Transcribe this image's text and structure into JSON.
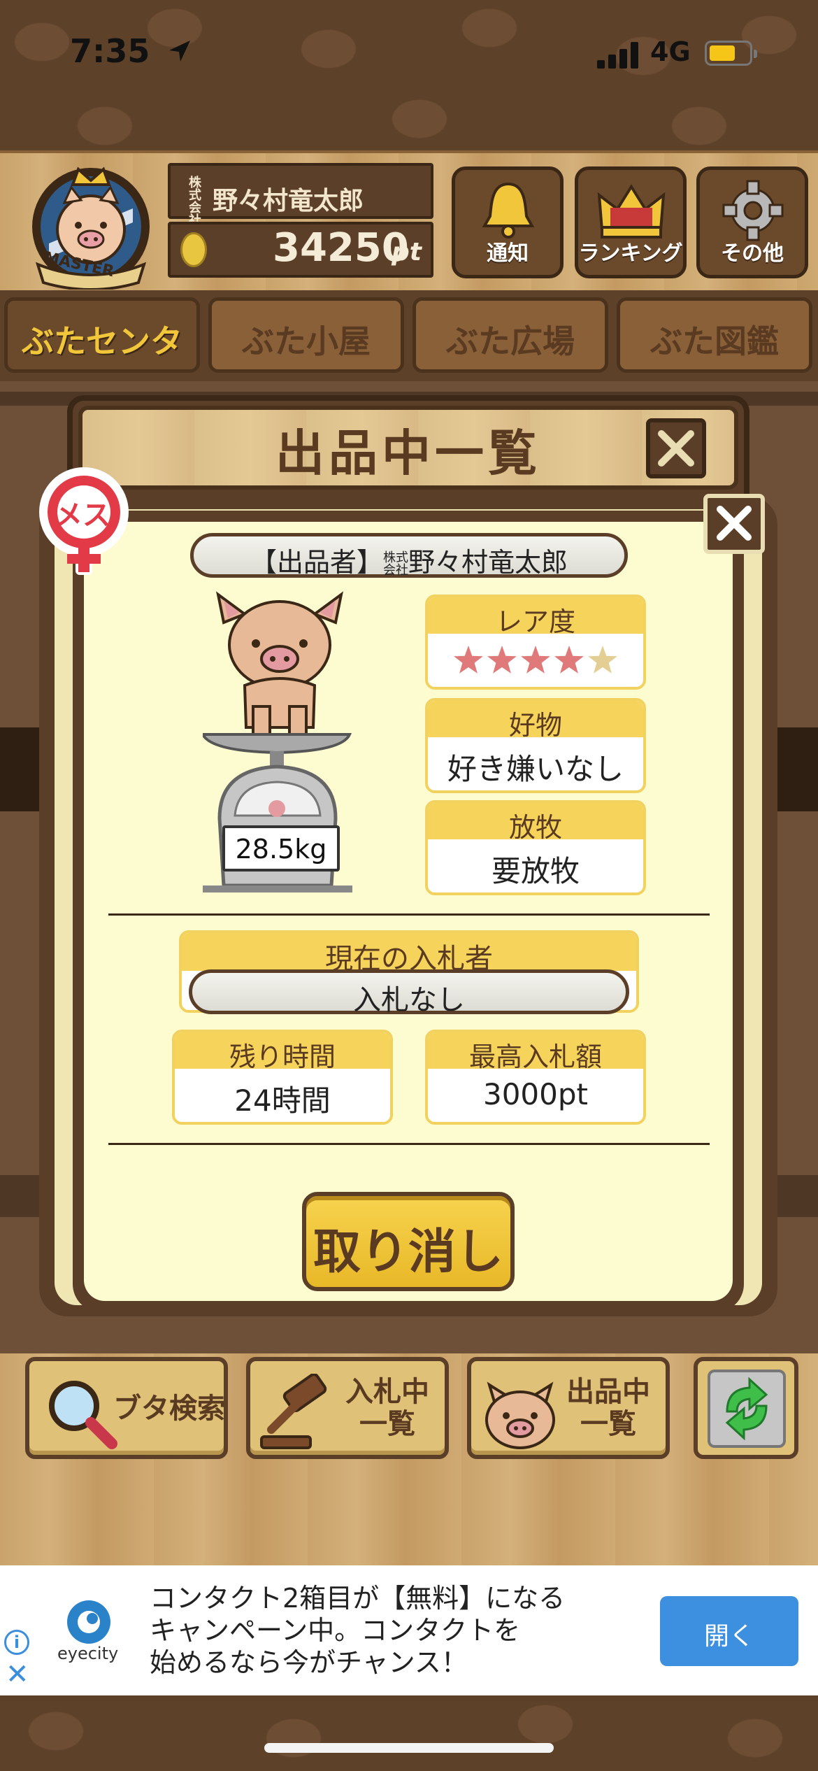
{
  "status_bar": {
    "time": "7:35",
    "network": "4G",
    "battery_color": "#f5c518"
  },
  "header": {
    "badge_text": "MASTER",
    "company_prefix": "株式会社",
    "player_name": "野々村竜太郎",
    "points_value": "34250",
    "points_unit": "pt",
    "buttons": [
      {
        "label": "通知",
        "icon": "bell-icon"
      },
      {
        "label": "ランキング",
        "icon": "crown-icon"
      },
      {
        "label": "その他",
        "icon": "gear-icon"
      }
    ]
  },
  "tabs": [
    {
      "label": "ぶたセンター",
      "active": true
    },
    {
      "label": "ぶた小屋",
      "active": false
    },
    {
      "label": "ぶた広場",
      "active": false
    },
    {
      "label": "ぶた図鑑",
      "active": false
    }
  ],
  "back_panel": {
    "title": "出品中一覧"
  },
  "listing": {
    "gender_label": "メス",
    "seller_prefix": "【出品者】",
    "seller_company": "株式会社",
    "seller_name": "野々村竜太郎",
    "weight": "28.5kg",
    "rarity_label": "レア度",
    "rarity_stars": 4,
    "rarity_max": 5,
    "preference_label": "好物",
    "preference_value": "好き嫌いなし",
    "grazing_label": "放牧",
    "grazing_value": "要放牧",
    "bidder_label": "現在の入札者",
    "bidder_value": "入札なし",
    "time_left_label": "残り時間",
    "time_left_value": "24時間",
    "max_bid_label": "最高入札額",
    "max_bid_value": "3000pt",
    "cancel_label": "取り消し"
  },
  "toolbar": {
    "search_label": "ブタ検索",
    "bidding_line1": "入札中",
    "bidding_line2": "一覧",
    "listing_line1": "出品中",
    "listing_line2": "一覧"
  },
  "ad": {
    "brand": "eyecity",
    "line1": "コンタクト2箱目が【無料】になる",
    "line2": "キャンペーン中。コンタクトを",
    "line3": "始めるなら今がチャンス！",
    "cta": "開く"
  },
  "colors": {
    "wood_dark": "#5a3e27",
    "accent_yellow": "#f6d35a",
    "modal_bg": "#fdfbd0",
    "star_active": "#e07a7a",
    "star_inactive": "#e3cf94",
    "ad_button": "#3d8fe0"
  }
}
